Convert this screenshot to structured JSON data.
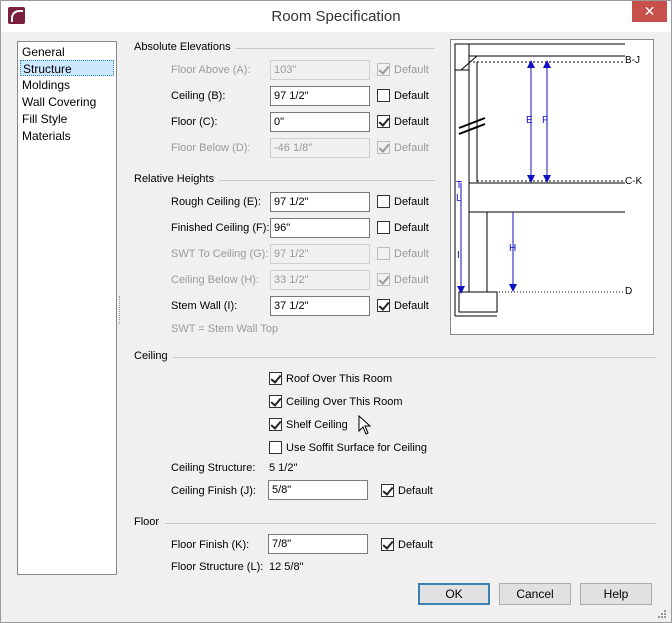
{
  "window": {
    "title": "Room Specification",
    "close_glyph": "✕"
  },
  "nav": {
    "items": [
      "General",
      "Structure",
      "Moldings",
      "Wall Covering",
      "Fill Style",
      "Materials"
    ],
    "selected": "Structure"
  },
  "absolute_elevations": {
    "heading": "Absolute Elevations",
    "rows": [
      {
        "label": "Floor Above (A):",
        "value": "103\"",
        "default": true,
        "enabled": false
      },
      {
        "label": "Ceiling (B):",
        "value": "97 1/2\"",
        "default": false,
        "enabled": true
      },
      {
        "label": "Floor (C):",
        "value": "0\"",
        "default": true,
        "enabled": true
      },
      {
        "label": "Floor Below (D):",
        "value": "-46 1/8\"",
        "default": true,
        "enabled": false
      }
    ]
  },
  "relative_heights": {
    "heading": "Relative Heights",
    "rows": [
      {
        "label": "Rough Ceiling (E):",
        "value": "97 1/2\"",
        "default": false,
        "enabled": true
      },
      {
        "label": "Finished Ceiling (F):",
        "value": "96\"",
        "default": false,
        "enabled": true
      },
      {
        "label": "SWT To Ceiling (G):",
        "value": "97 1/2\"",
        "default": false,
        "enabled": false
      },
      {
        "label": "Ceiling Below (H):",
        "value": "33 1/2\"",
        "default": true,
        "enabled": false
      },
      {
        "label": "Stem Wall (I):",
        "value": "37 1/2\"",
        "default": true,
        "enabled": true
      }
    ],
    "note": "SWT = Stem Wall Top"
  },
  "default_label": "Default",
  "ceiling": {
    "heading": "Ceiling",
    "options": [
      {
        "label": "Roof Over This Room",
        "checked": true
      },
      {
        "label": "Ceiling Over This Room",
        "checked": true
      },
      {
        "label": "Shelf Ceiling",
        "checked": true
      },
      {
        "label": "Use Soffit Surface for Ceiling",
        "checked": false
      }
    ],
    "structure_label": "Ceiling Structure:",
    "structure_value": "5 1/2\"",
    "finish_label": "Ceiling Finish (J):",
    "finish_value": "5/8\"",
    "finish_default": true
  },
  "floor": {
    "heading": "Floor",
    "finish_label": "Floor Finish (K):",
    "finish_value": "7/8\"",
    "finish_default": true,
    "structure_label": "Floor Structure (L):",
    "structure_value": "12 5/8\""
  },
  "diagram": {
    "labels": [
      "B-J",
      "E",
      "F",
      "C-K",
      "T",
      "L",
      "I",
      "H",
      "D"
    ]
  },
  "buttons": {
    "ok": "OK",
    "cancel": "Cancel",
    "help": "Help"
  }
}
